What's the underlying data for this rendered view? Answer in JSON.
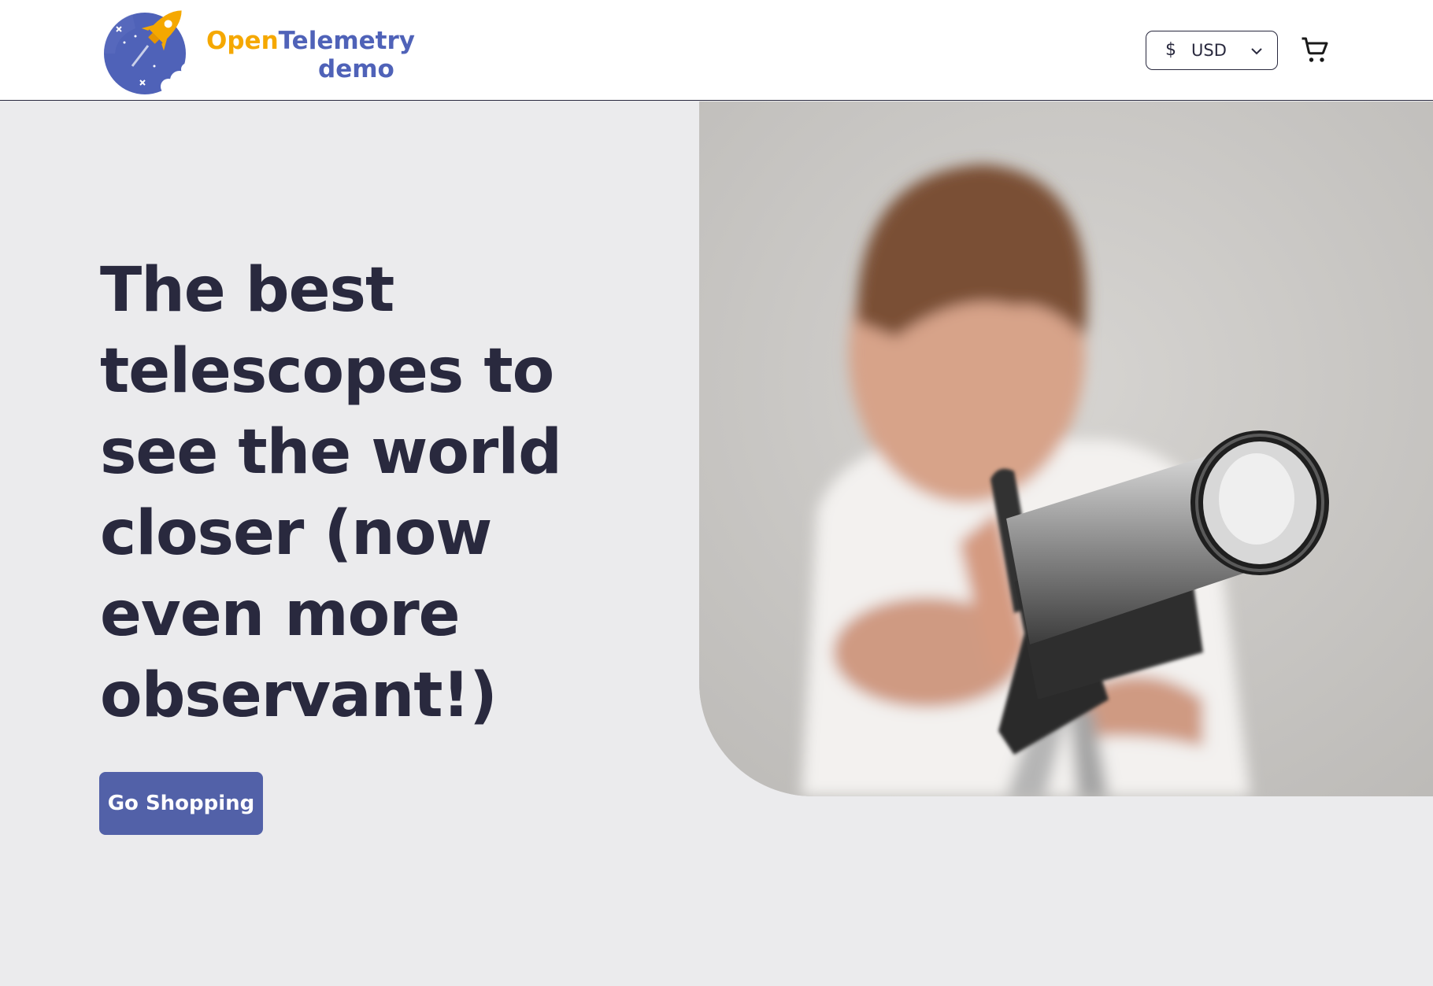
{
  "header": {
    "logo": {
      "word_open": "Open",
      "word_telemetry": "Telemetry",
      "word_demo": "demo"
    },
    "currency": {
      "symbol": "$",
      "code": "USD"
    },
    "cart_icon": "cart-icon"
  },
  "hero": {
    "headline": "The best telescopes to see the world closer (now even more observant!)",
    "cta_label": "Go Shopping"
  },
  "colors": {
    "brand_blue": "#4f62b8",
    "brand_orange": "#f5a800",
    "button": "#5261a8",
    "text_dark": "#29293e",
    "page_bg": "#ebebed"
  }
}
